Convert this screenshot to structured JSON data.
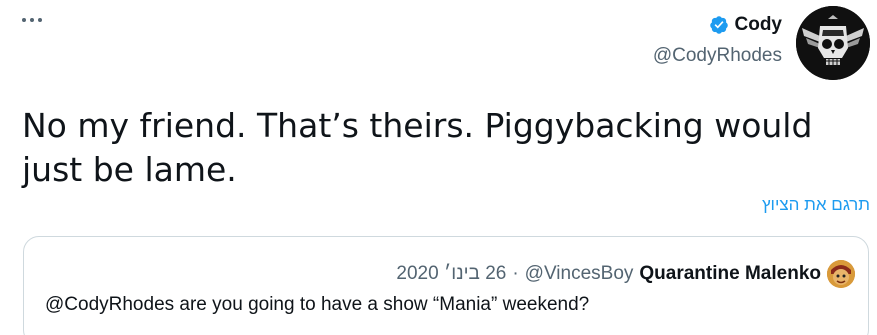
{
  "tweet": {
    "author_name": "Cody",
    "author_handle": "@CodyRhodes",
    "text": "No my friend. That’s theirs. Piggybacking would just be lame.",
    "translate_label": "תרגם את הציוץ"
  },
  "quoted_tweet": {
    "author_name": "Quarantine Malenko",
    "author_handle": "@VincesBoy",
    "separator": "·",
    "date": "26 בינו׳ 2020",
    "text": "@CodyRhodes are you going to have a show “Mania” weekend?"
  },
  "icons": {
    "more": "more-horizontal-icon",
    "verified": "verified-badge-icon"
  },
  "colors": {
    "link": "#1d9bf0",
    "secondary_text": "#536471",
    "border": "#cfd9de",
    "primary_text": "#0f1419"
  }
}
